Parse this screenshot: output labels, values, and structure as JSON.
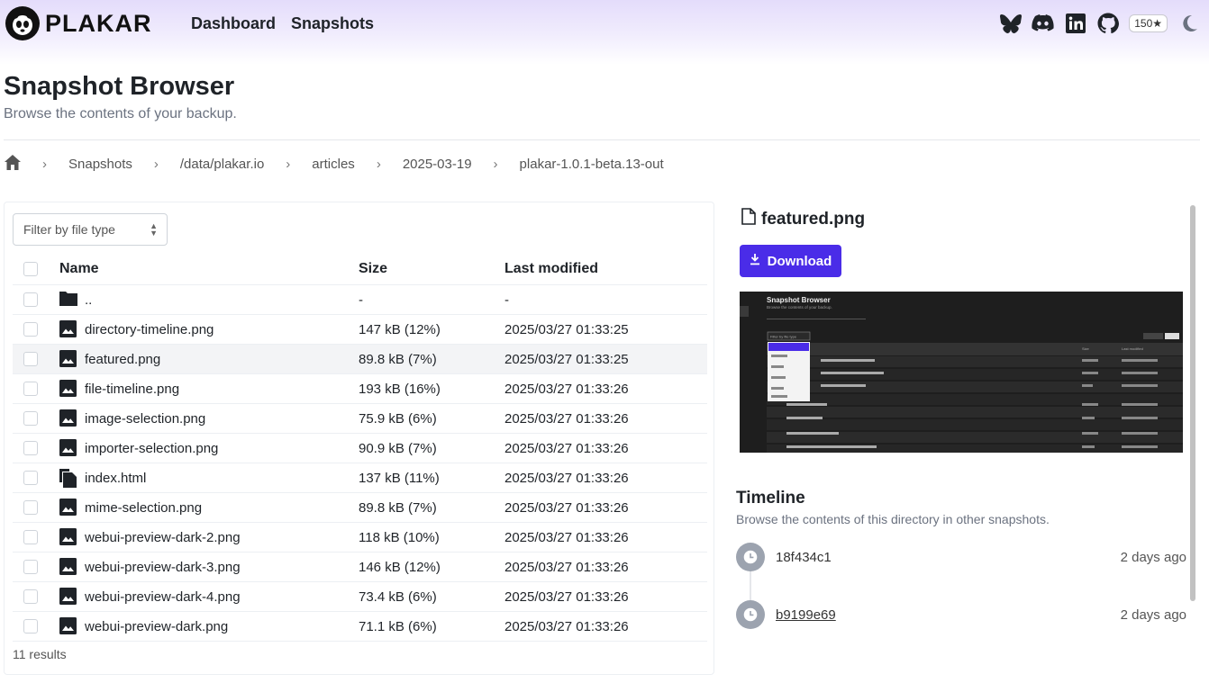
{
  "app": {
    "logo_text": "PLAKAR"
  },
  "nav": {
    "items": [
      {
        "label": "Dashboard"
      },
      {
        "label": "Snapshots"
      }
    ]
  },
  "social": {
    "stars": "150★",
    "icons": [
      "bluesky-icon",
      "discord-icon",
      "linkedin-icon",
      "github-icon",
      "moon-icon"
    ]
  },
  "page": {
    "title": "Snapshot Browser",
    "subtitle": "Browse the contents of your backup."
  },
  "breadcrumb": [
    "Snapshots",
    "/data/plakar.io",
    "articles",
    "2025-03-19",
    "plakar-1.0.1-beta.13-out"
  ],
  "filter": {
    "placeholder": "Filter by file type"
  },
  "table": {
    "headers": {
      "name": "Name",
      "size": "Size",
      "modified": "Last modified"
    },
    "rows": [
      {
        "name": "..",
        "icon": "folder-icon",
        "size": "-",
        "modified": "-"
      },
      {
        "name": "directory-timeline.png",
        "icon": "image-icon",
        "size": "147 kB (12%)",
        "modified": "2025/03/27 01:33:25"
      },
      {
        "name": "featured.png",
        "icon": "image-icon",
        "size": "89.8 kB (7%)",
        "modified": "2025/03/27 01:33:25"
      },
      {
        "name": "file-timeline.png",
        "icon": "image-icon",
        "size": "193 kB (16%)",
        "modified": "2025/03/27 01:33:26"
      },
      {
        "name": "image-selection.png",
        "icon": "image-icon",
        "size": "75.9 kB (6%)",
        "modified": "2025/03/27 01:33:26"
      },
      {
        "name": "importer-selection.png",
        "icon": "image-icon",
        "size": "90.9 kB (7%)",
        "modified": "2025/03/27 01:33:26"
      },
      {
        "name": "index.html",
        "icon": "file-copy-icon",
        "size": "137 kB (11%)",
        "modified": "2025/03/27 01:33:26"
      },
      {
        "name": "mime-selection.png",
        "icon": "image-icon",
        "size": "89.8 kB (7%)",
        "modified": "2025/03/27 01:33:26"
      },
      {
        "name": "webui-preview-dark-2.png",
        "icon": "image-icon",
        "size": "118 kB (10%)",
        "modified": "2025/03/27 01:33:26"
      },
      {
        "name": "webui-preview-dark-3.png",
        "icon": "image-icon",
        "size": "146 kB (12%)",
        "modified": "2025/03/27 01:33:26"
      },
      {
        "name": "webui-preview-dark-4.png",
        "icon": "image-icon",
        "size": "73.4 kB (6%)",
        "modified": "2025/03/27 01:33:26"
      },
      {
        "name": "webui-preview-dark.png",
        "icon": "image-icon",
        "size": "71.1 kB (6%)",
        "modified": "2025/03/27 01:33:26"
      }
    ],
    "results": "11 results"
  },
  "preview": {
    "filename": "featured.png",
    "download_label": "Download",
    "thumbnail": {
      "title": "Snapshot Browser",
      "subtitle": "Browse the contents of your backup.",
      "filter": "Filter by file type",
      "col_size": "Size",
      "col_modified": "Last modified"
    }
  },
  "timeline": {
    "title": "Timeline",
    "subtitle": "Browse the contents of this directory in other snapshots.",
    "items": [
      {
        "id": "18f434c1",
        "ago": "2 days ago"
      },
      {
        "id": "b9199e69",
        "ago": "2 days ago"
      }
    ]
  },
  "colors": {
    "accent": "#4a2ce8",
    "timeline_dot": "#9ca3af"
  }
}
